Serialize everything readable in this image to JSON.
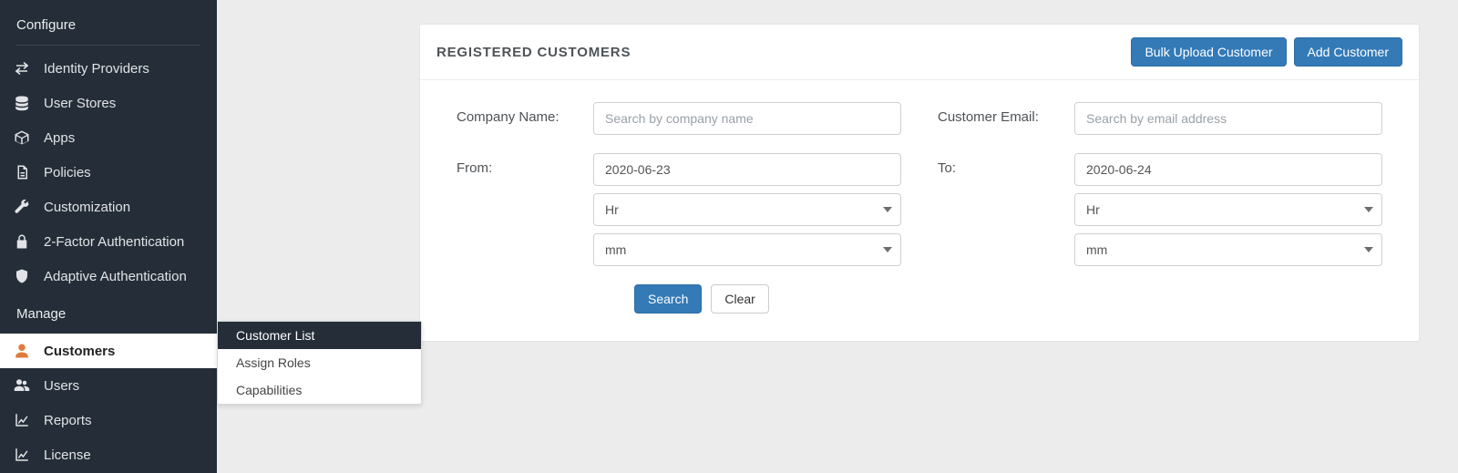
{
  "sidebar": {
    "section_configure": "Configure",
    "section_manage": "Manage",
    "items_configure": [
      {
        "label": "Identity Providers"
      },
      {
        "label": "User Stores"
      },
      {
        "label": "Apps"
      },
      {
        "label": "Policies"
      },
      {
        "label": "Customization"
      },
      {
        "label": "2-Factor Authentication"
      },
      {
        "label": "Adaptive Authentication"
      }
    ],
    "items_manage": [
      {
        "label": "Customers"
      },
      {
        "label": "Users"
      },
      {
        "label": "Reports"
      },
      {
        "label": "License"
      }
    ]
  },
  "submenu": {
    "items": [
      {
        "label": "Customer List"
      },
      {
        "label": "Assign Roles"
      },
      {
        "label": "Capabilities"
      }
    ]
  },
  "header": {
    "title": "REGISTERED CUSTOMERS",
    "bulk_upload": "Bulk Upload Customer",
    "add_customer": "Add Customer"
  },
  "filters": {
    "company_label": "Company Name:",
    "company_placeholder": "Search by company name",
    "email_label": "Customer Email:",
    "email_placeholder": "Search by email address",
    "from_label": "From:",
    "from_date": "2020-06-23",
    "to_label": "To:",
    "to_date": "2020-06-24",
    "hr_option": "Hr",
    "mm_option": "mm",
    "search": "Search",
    "clear": "Clear"
  }
}
